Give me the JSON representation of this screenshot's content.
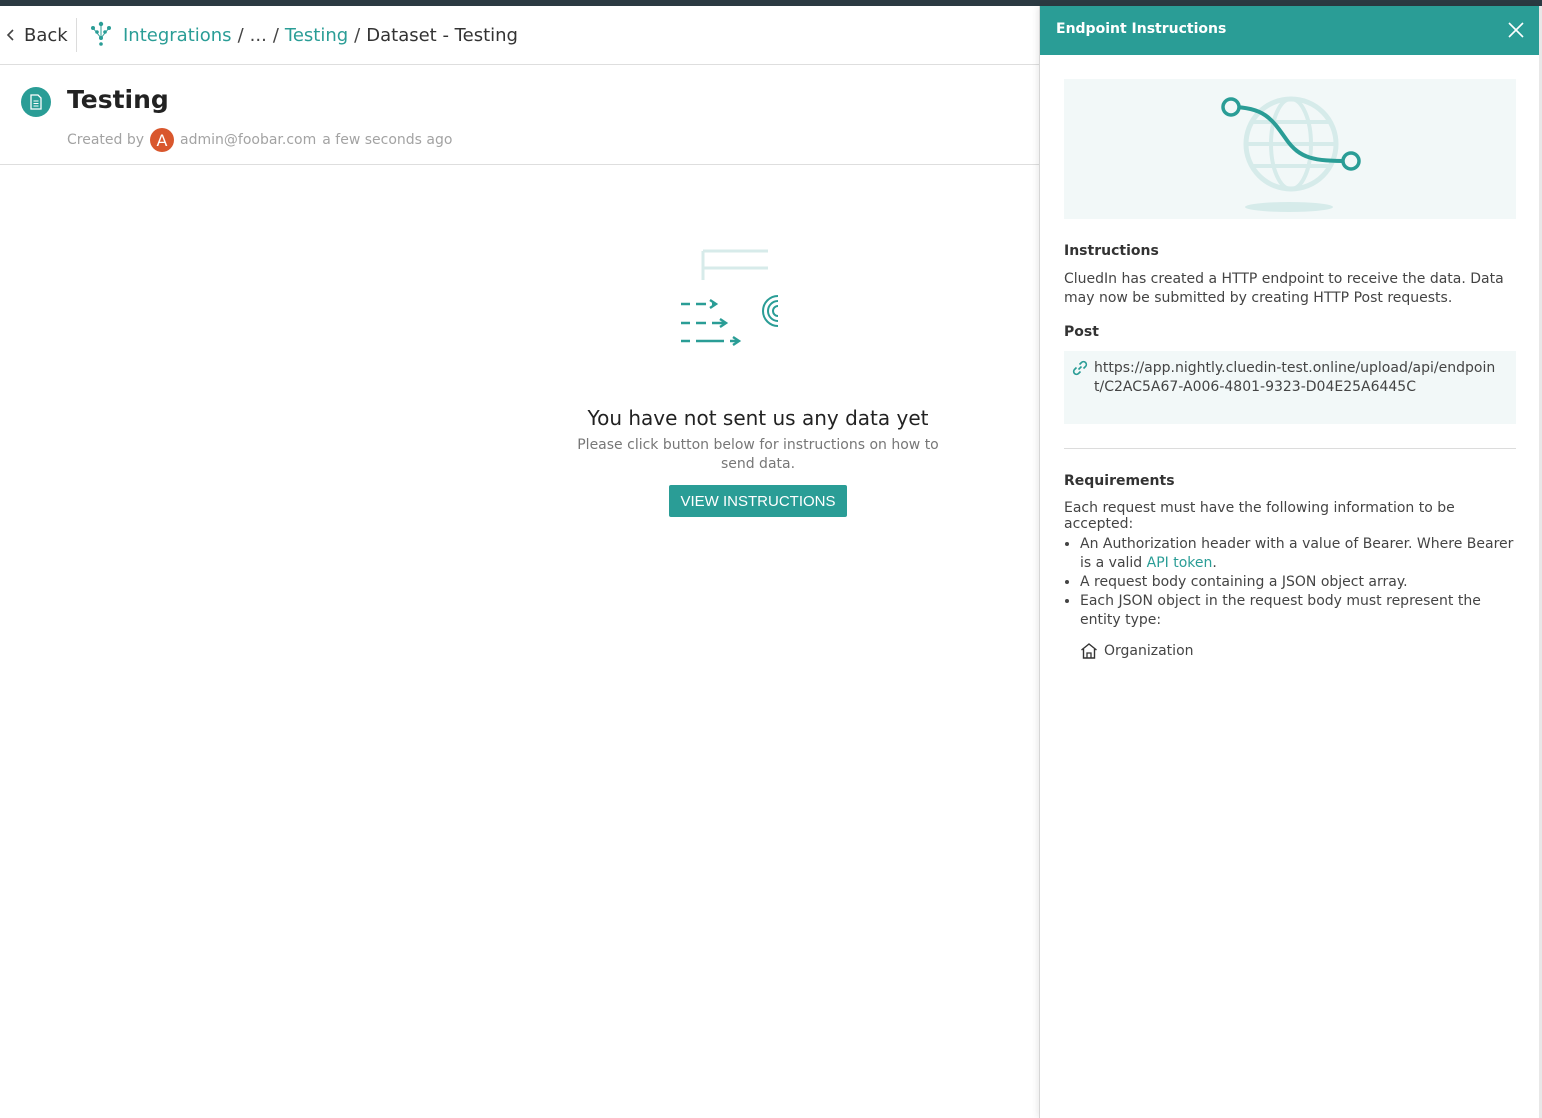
{
  "topbar": {
    "back_label": "Back",
    "breadcrumbs": {
      "integrations": "Integrations",
      "ellipsis": "...",
      "testing": "Testing",
      "current": "Dataset - Testing",
      "separator": "/"
    }
  },
  "header": {
    "title": "Testing",
    "created_by_label": "Created by",
    "avatar_letter": "A",
    "author": "admin@foobar.com",
    "time": "a few seconds ago"
  },
  "empty_state": {
    "title": "You have not sent us any data yet",
    "subtitle": "Please click button below for instructions on how to send data.",
    "button_label": "VIEW INSTRUCTIONS"
  },
  "panel": {
    "title": "Endpoint Instructions",
    "instructions_heading": "Instructions",
    "instructions_text": "CluedIn has created a HTTP endpoint to receive the data. Data may now be submitted by creating HTTP Post requests.",
    "post_heading": "Post",
    "post_url": "https://app.nightly.cluedin-test.online/upload/api/endpoint/C2AC5A67-A006-4801-9323-D04E25A6445C",
    "requirements_heading": "Requirements",
    "requirements_text": "Each request must have the following information to be accepted:",
    "req_1_text": "An Authorization header with a value of Bearer. Where Bearer is a valid",
    "req_1_link": "API token",
    "req_1_end": ".",
    "req_2": "A request body containing a JSON object array.",
    "req_3": "Each JSON object in the request body must represent the entity type:",
    "entity_type": "Organization"
  },
  "colors": {
    "accent": "#2a9d96",
    "avatar": "#d9572d",
    "hero_bg": "#f2f8f8"
  }
}
